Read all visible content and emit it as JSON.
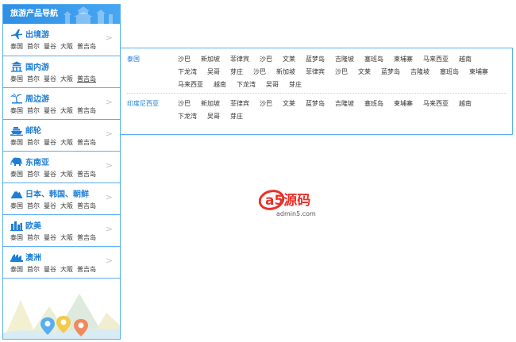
{
  "nav": {
    "header": "旅游产品导航",
    "arrow": ">",
    "categories": [
      {
        "title": "出境游",
        "icon": "airplane-icon",
        "links": [
          "泰国",
          "首尔",
          "曼谷",
          "大阪",
          "普吉岛"
        ]
      },
      {
        "title": "国内游",
        "icon": "palace-icon",
        "links": [
          "泰国",
          "首尔",
          "曼谷",
          "大阪",
          "普吉岛"
        ]
      },
      {
        "title": "周边游",
        "icon": "palm-tree-icon",
        "links": [
          "泰国",
          "首尔",
          "曼谷",
          "大阪",
          "普吉岛"
        ]
      },
      {
        "title": "邮轮",
        "icon": "cruise-ship-icon",
        "links": [
          "泰国",
          "首尔",
          "曼谷",
          "大阪",
          "普吉岛"
        ]
      },
      {
        "title": "东南亚",
        "icon": "elephant-icon",
        "links": [
          "泰国",
          "首尔",
          "曼谷",
          "大阪",
          "普吉岛"
        ]
      },
      {
        "title": "日本、韩国、朝鲜",
        "icon": "mountain-icon",
        "links": [
          "泰国",
          "首尔",
          "曼谷",
          "大阪",
          "普吉岛"
        ]
      },
      {
        "title": "欧美",
        "icon": "city-icon",
        "links": [
          "泰国",
          "首尔",
          "曼谷",
          "大阪",
          "普吉岛"
        ]
      },
      {
        "title": "澳洲",
        "icon": "opera-house-icon",
        "links": [
          "泰国",
          "首尔",
          "曼谷",
          "大阪",
          "普吉岛"
        ]
      }
    ]
  },
  "dropdown": {
    "regions": [
      {
        "name": "泰国",
        "destinations": [
          "沙巴",
          "新加坡",
          "菲律宾",
          "沙巴",
          "文莱",
          "蓝梦岛",
          "吉隆坡",
          "塞班岛",
          "柬埔寨",
          "马来西亚",
          "越南",
          "下龙湾",
          "吴哥",
          "芽庄",
          "沙巴",
          "新加坡",
          "菲律宾",
          "沙巴",
          "文莱",
          "蓝梦岛",
          "吉隆坡",
          "塞班岛",
          "柬埔寨",
          "马来西亚",
          "越南",
          "下龙湾",
          "吴哥",
          "芽庄"
        ]
      },
      {
        "name": "印度尼西亚",
        "destinations": [
          "沙巴",
          "新加坡",
          "菲律宾",
          "沙巴",
          "文莱",
          "蓝梦岛",
          "吉隆坡",
          "塞班岛",
          "柬埔寨",
          "马来西亚",
          "越南",
          "下龙湾",
          "吴哥",
          "芽庄"
        ]
      }
    ]
  },
  "watermark": {
    "logo_text": "a5源码",
    "url": "admin5.com"
  },
  "colors": {
    "accent": "#1e7ed6",
    "border": "#5aaef0",
    "header": "#2e8fe6",
    "watermark": "#e8322a"
  }
}
